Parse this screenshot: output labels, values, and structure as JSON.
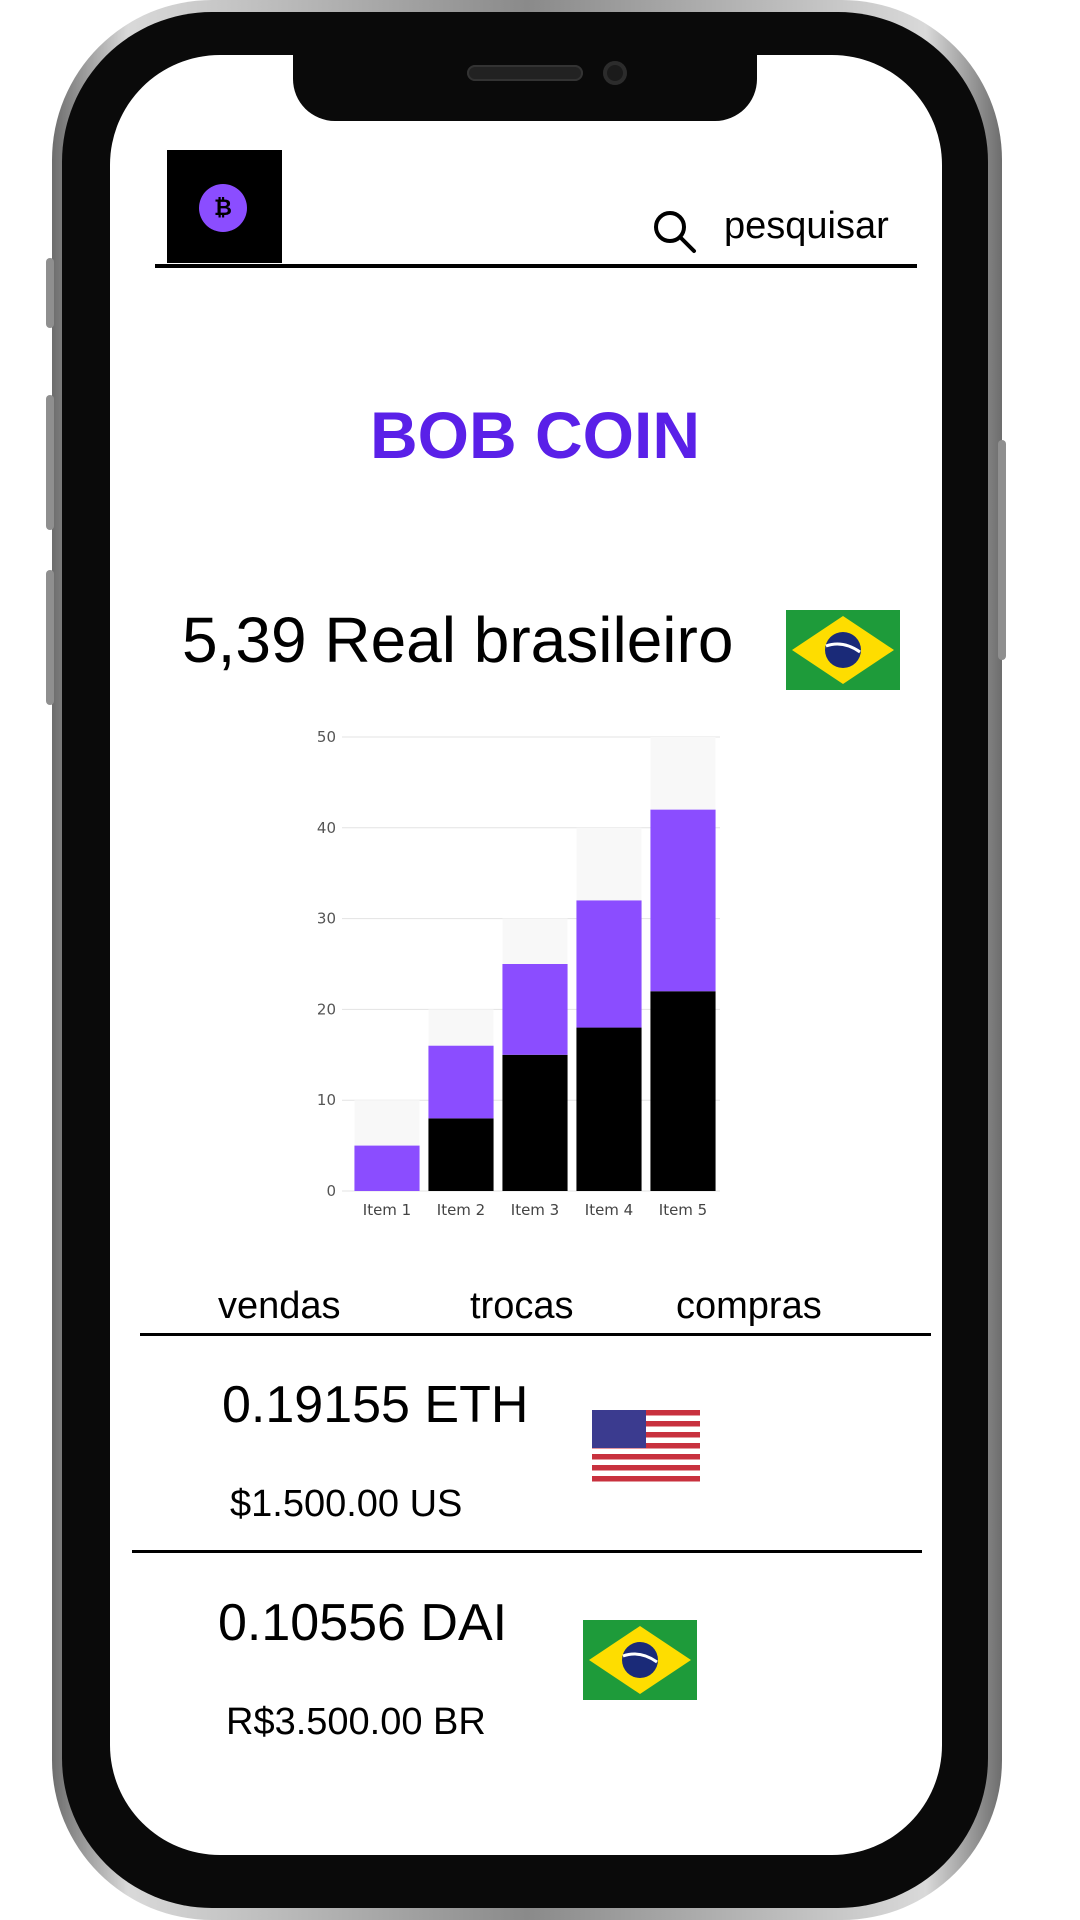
{
  "app": {
    "brand_mark": "₿",
    "search_label": "pesquisar",
    "title": "BOB COIN",
    "rate_text": "5,39 Real brasileiro"
  },
  "tabs": [
    {
      "label": "vendas"
    },
    {
      "label": "trocas"
    },
    {
      "label": "compras"
    }
  ],
  "conversions": [
    {
      "amount": "0.19155 ETH",
      "fiat": "$1.500.00 US",
      "flag": "us-flag"
    },
    {
      "amount": "0.10556 DAI",
      "fiat": "R$3.500.00 BR",
      "flag": "brazil-flag"
    }
  ],
  "colors": {
    "accent": "#5a20e8",
    "bar_top": "#8b4dff",
    "bar_bottom": "#000000"
  },
  "chart_data": {
    "type": "bar",
    "stacked": true,
    "categories": [
      "Item 1",
      "Item 2",
      "Item 3",
      "Item 4",
      "Item 5"
    ],
    "series": [
      {
        "values": [
          0,
          8,
          15,
          18,
          22
        ],
        "color": "#000000"
      },
      {
        "values": [
          5,
          8,
          10,
          14,
          20
        ],
        "color": "#8b4dff"
      }
    ],
    "yticks": [
      0,
      10,
      20,
      30,
      40,
      50
    ],
    "ylim": [
      0,
      50
    ],
    "grid": true
  }
}
